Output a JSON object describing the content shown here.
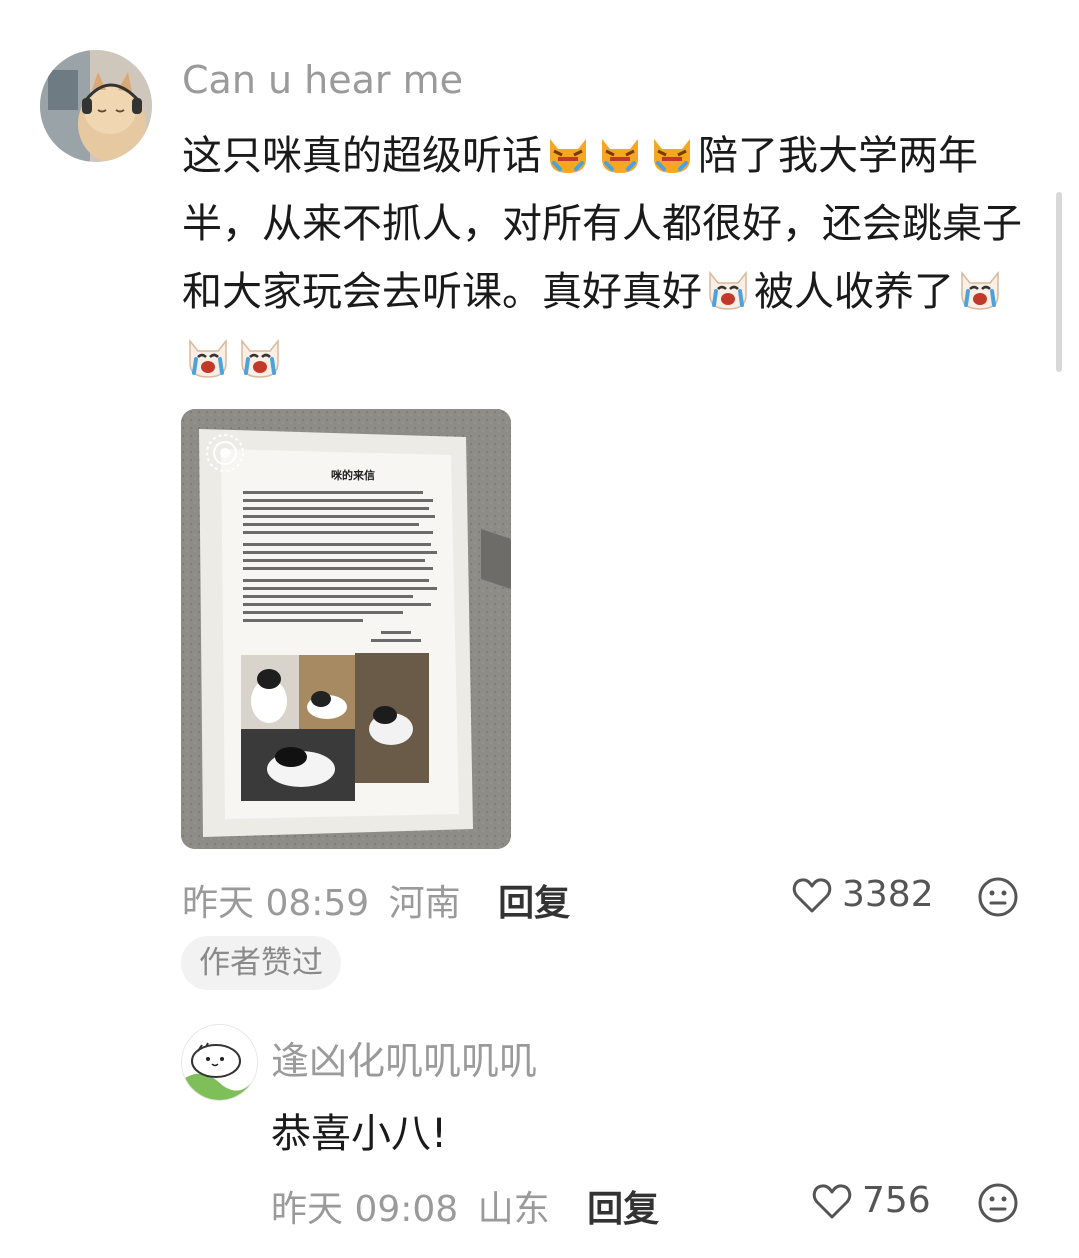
{
  "main_comment": {
    "username": "Can u hear me",
    "text_parts": [
      {
        "type": "text",
        "value": "这只咪真的超级听话"
      },
      {
        "type": "emoji",
        "name": "angry-cat-emoji"
      },
      {
        "type": "emoji",
        "name": "angry-cat-emoji"
      },
      {
        "type": "emoji",
        "name": "angry-cat-emoji"
      },
      {
        "type": "text",
        "value": "陪了我大学两年半，从来不抓人，对所有人都很好，还会跳桌子和大家玩会去听课。真好真好"
      },
      {
        "type": "emoji",
        "name": "crying-dog-emoji"
      },
      {
        "type": "text",
        "value": "被人收养了"
      },
      {
        "type": "emoji",
        "name": "crying-dog-emoji"
      },
      {
        "type": "emoji",
        "name": "crying-dog-emoji"
      },
      {
        "type": "emoji",
        "name": "crying-dog-emoji"
      }
    ],
    "image": {
      "letter_title": "咪的来信",
      "live_icon": "live-photo-icon"
    },
    "time": "昨天 08:59",
    "location": "河南",
    "reply_label": "回复",
    "like_count": "3382",
    "author_liked_label": "作者赞过"
  },
  "reply_comment": {
    "username": "逢凶化叽叽叽叽",
    "text": "恭喜小八!",
    "time": "昨天 09:08",
    "location": "山东",
    "reply_label": "回复",
    "like_count": "756"
  },
  "icons": {
    "like": "heart-outline-icon",
    "dislike": "neutral-face-icon"
  },
  "colors": {
    "meta_gray": "#9a9a9a",
    "text_dark": "#1a1a1a",
    "pill_bg": "#f2f2f2"
  }
}
